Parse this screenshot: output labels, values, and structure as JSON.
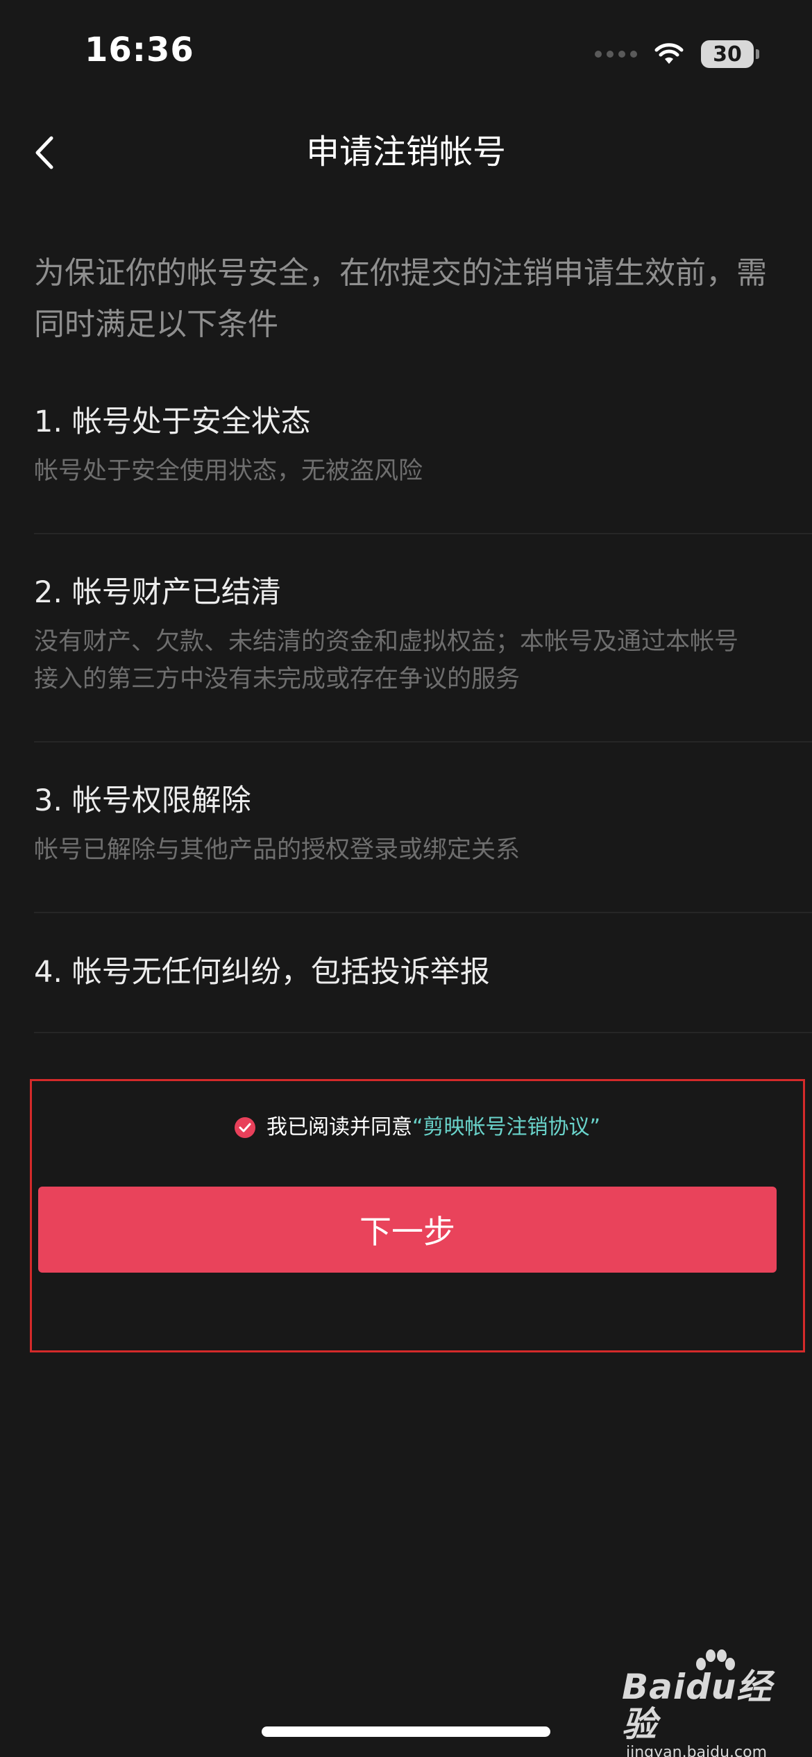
{
  "status_bar": {
    "time": "16:36",
    "battery": "30"
  },
  "nav": {
    "title": "申请注销帐号"
  },
  "intro": {
    "text": "为保证你的帐号安全，在你提交的注销申请生效前，需同时满足以下条件"
  },
  "conditions": [
    {
      "title": "1. 帐号处于安全状态",
      "desc": "帐号处于安全使用状态，无被盗风险"
    },
    {
      "title": "2. 帐号财产已结清",
      "desc": "没有财产、欠款、未结清的资金和虚拟权益；本帐号及通过本帐号接入的第三方中没有未完成或存在争议的服务"
    },
    {
      "title": "3. 帐号权限解除",
      "desc": "帐号已解除与其他产品的授权登录或绑定关系"
    },
    {
      "title": "4. 帐号无任何纠纷，包括投诉举报",
      "desc": ""
    }
  ],
  "agreement": {
    "prefix": "我已阅读并同意",
    "link": "“剪映帐号注销协议”",
    "checked": true
  },
  "next_button": {
    "label": "下一步"
  },
  "colors": {
    "background": "#181818",
    "accent": "#e9435b",
    "link": "#6ad4cb",
    "highlight_border": "#d42a2a"
  },
  "watermark": {
    "main": "Baidu经验",
    "sub": "jingyan.baidu.com"
  }
}
